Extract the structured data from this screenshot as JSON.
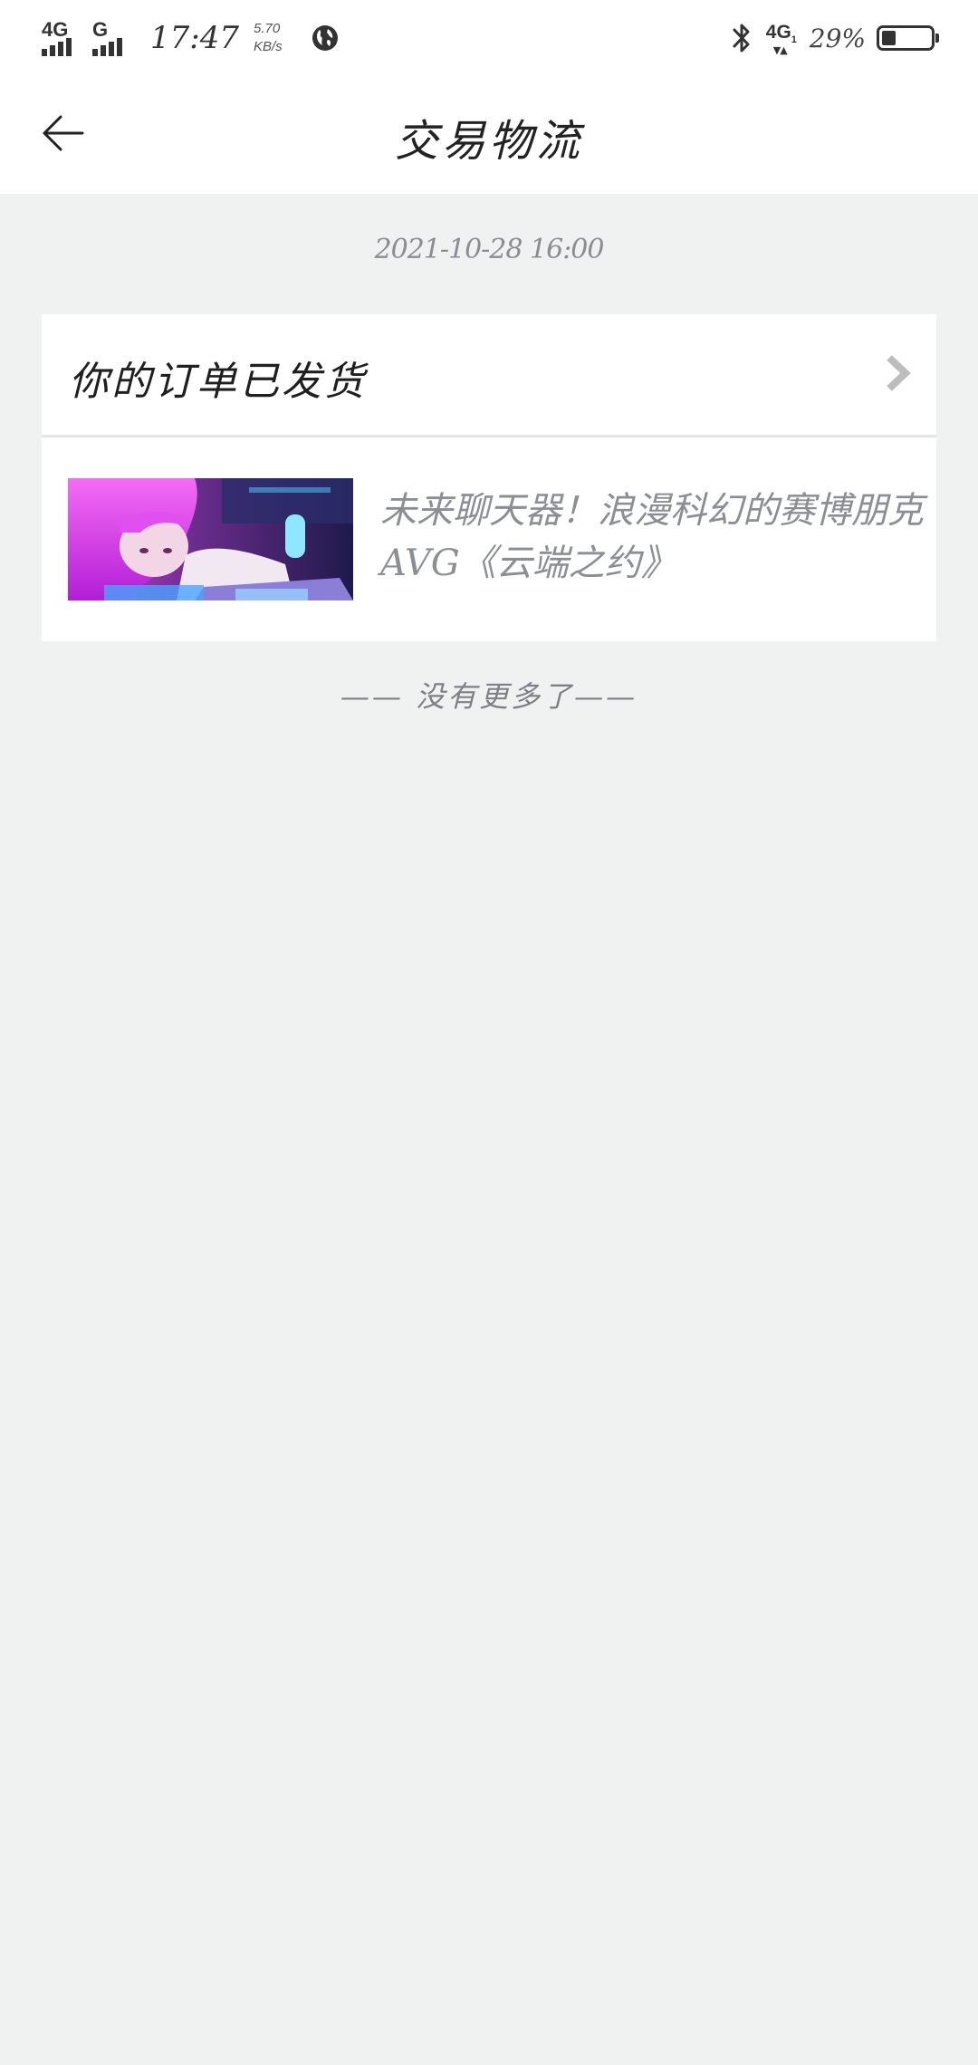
{
  "status_bar": {
    "net1_label": "4G",
    "net2_label": "G",
    "time": "17:47",
    "speed_value": "5.70",
    "speed_unit": "KB/s",
    "net_right_label": "4G",
    "net_right_sub": "1",
    "battery_pct_text": "29%",
    "battery_level": 0.29,
    "icons": [
      "signal-icon",
      "globe-icon",
      "bluetooth-icon",
      "battery-icon"
    ]
  },
  "header": {
    "title": "交易物流",
    "back_icon": "arrow-left-icon"
  },
  "entry": {
    "timestamp": "2021-10-28 16:00",
    "card_title": "你的订单已发货",
    "chevron_icon": "chevron-right-icon",
    "product_title": "未来聊天器！浪漫科幻的赛博朋克AVG《云端之约》"
  },
  "footer": {
    "end_note": "—— 没有更多了——"
  },
  "colors": {
    "background": "#f0f1f1",
    "card": "#ffffff",
    "muted_text": "#8b8f94",
    "thumb_accent": "#c933e8"
  }
}
